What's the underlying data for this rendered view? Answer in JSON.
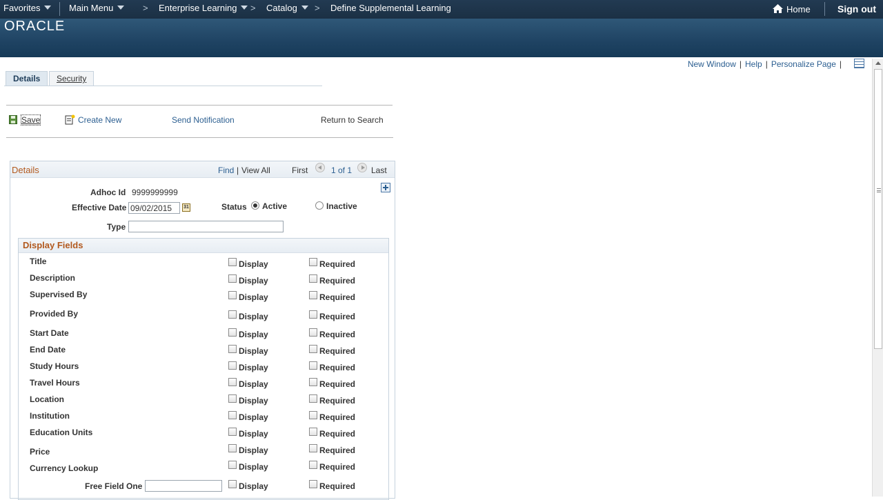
{
  "nav": {
    "favorites": "Favorites",
    "main_menu": "Main Menu",
    "breadcrumb": [
      "Enterprise Learning",
      "Catalog",
      "Define Supplemental Learning"
    ],
    "home": "Home",
    "sign_out": "Sign out"
  },
  "brand": {
    "logo": "ORACLE"
  },
  "toplinks": {
    "new_window": "New Window",
    "help": "Help",
    "personalize": "Personalize Page"
  },
  "tabs": [
    {
      "label": "Details",
      "active": true
    },
    {
      "label": "Security",
      "active": false
    }
  ],
  "toolbar": {
    "save": "Save",
    "create_new": "Create New",
    "send_notification": "Send Notification",
    "return_to_search": "Return to Search"
  },
  "panel": {
    "title": "Details",
    "find": "Find",
    "sep": "|",
    "view_all": "View All",
    "first": "First",
    "page_info": "1 of 1",
    "last": "Last"
  },
  "form": {
    "adhoc_id_label": "Adhoc Id",
    "adhoc_id": "9999999999",
    "effective_date_label": "Effective Date",
    "effective_date": "09/02/2015",
    "calendar_glyph": "31",
    "status_label": "Status",
    "status_active": "Active",
    "status_inactive": "Inactive",
    "status_selected": "Active",
    "type_label": "Type",
    "type_value": ""
  },
  "display_fields": {
    "title": "Display Fields",
    "display_label": "Display",
    "required_label": "Required",
    "rows": [
      {
        "name": "Title"
      },
      {
        "name": "Description"
      },
      {
        "name": "Supervised By"
      },
      {
        "name": "Provided By"
      },
      {
        "name": "Start Date"
      },
      {
        "name": "End Date"
      },
      {
        "name": "Study Hours"
      },
      {
        "name": "Travel Hours"
      },
      {
        "name": "Location"
      },
      {
        "name": "Institution"
      },
      {
        "name": "Education Units"
      },
      {
        "name": "Price"
      },
      {
        "name": "Currency Lookup"
      }
    ],
    "free_field_one_label": "Free Field One",
    "free_field_one_value": ""
  },
  "colors": {
    "nav_bg": "#1b3044",
    "banner_bg": "#1f4363",
    "link": "#2b5e90",
    "section_title": "#b2591e"
  }
}
